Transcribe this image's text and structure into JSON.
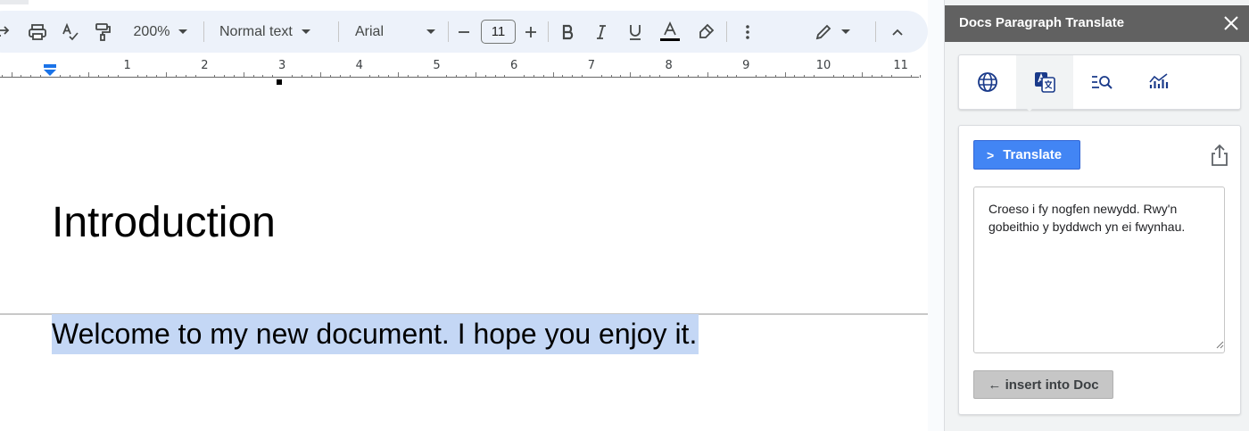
{
  "toolbar": {
    "zoom": "200%",
    "paragraph_style": "Normal text",
    "font_family": "Arial",
    "font_size": "11",
    "text_color": "#000000",
    "accent": "#edf2fa"
  },
  "ruler": {
    "numbers": [
      "1",
      "2",
      "3",
      "4",
      "5",
      "6",
      "7",
      "8",
      "9",
      "10",
      "11"
    ]
  },
  "document": {
    "heading": "Introduction",
    "paragraph": "Welcome to my new document. I hope you enjoy it."
  },
  "sidebar": {
    "title": "Docs Paragraph Translate",
    "tabs": [
      {
        "icon": "globe-icon"
      },
      {
        "icon": "translate-icon",
        "active": true
      },
      {
        "icon": "search-list-icon"
      },
      {
        "icon": "analytics-icon"
      }
    ],
    "translate_label": "Translate",
    "chevron": ">",
    "output_text": "Croeso i fy nogfen newydd. Rwy'n gobeithio y byddwch yn ei fwynhau.",
    "insert_label": "← insert into Doc",
    "header_color": "#616161",
    "button_color": "#4285f4"
  }
}
